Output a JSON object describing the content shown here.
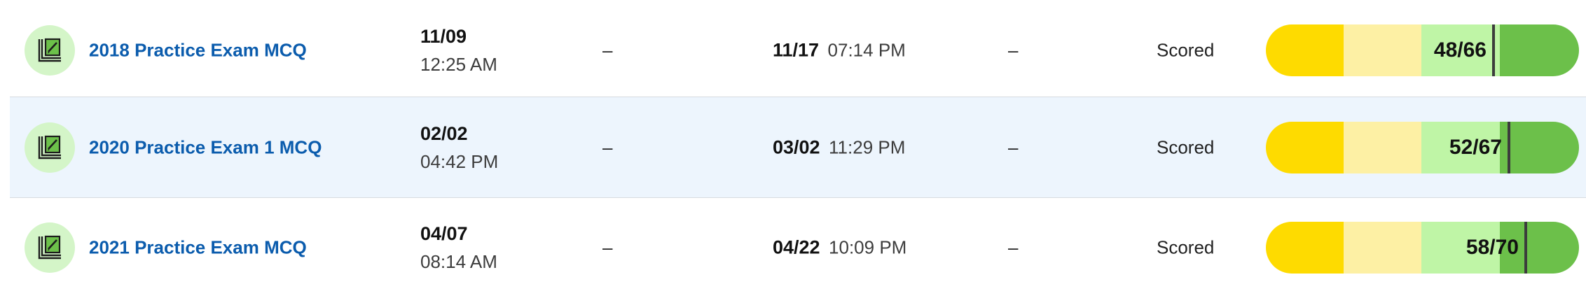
{
  "colors": {
    "link": "#0b5cad",
    "row_highlight": "#edf5fd",
    "icon_circle": "#d4f5c8",
    "band_1": "#fedb00",
    "band_2": "#fdf0a4",
    "band_3": "#bff5a6",
    "band_4": "#6cc04a"
  },
  "assignments": [
    {
      "icon": "exam-icon",
      "title": "2018 Practice Exam MCQ",
      "assigned_date": "11/09",
      "assigned_time": "12:25 AM",
      "start_dash": "–",
      "due_date": "11/17",
      "due_time": "07:14 PM",
      "submitted_dash": "–",
      "status": "Scored",
      "score_label": "48/66",
      "score_fraction": 0.727
    },
    {
      "icon": "exam-icon",
      "title": "2020 Practice Exam 1 MCQ",
      "assigned_date": "02/02",
      "assigned_time": "04:42 PM",
      "start_dash": "–",
      "due_date": "03/02",
      "due_time": "11:29 PM",
      "submitted_dash": "–",
      "status": "Scored",
      "score_label": "52/67",
      "score_fraction": 0.776
    },
    {
      "icon": "exam-icon",
      "title": "2021 Practice Exam MCQ",
      "assigned_date": "04/07",
      "assigned_time": "08:14 AM",
      "start_dash": "–",
      "due_date": "04/22",
      "due_time": "10:09 PM",
      "submitted_dash": "–",
      "status": "Scored",
      "score_label": "58/70",
      "score_fraction": 0.829
    }
  ]
}
